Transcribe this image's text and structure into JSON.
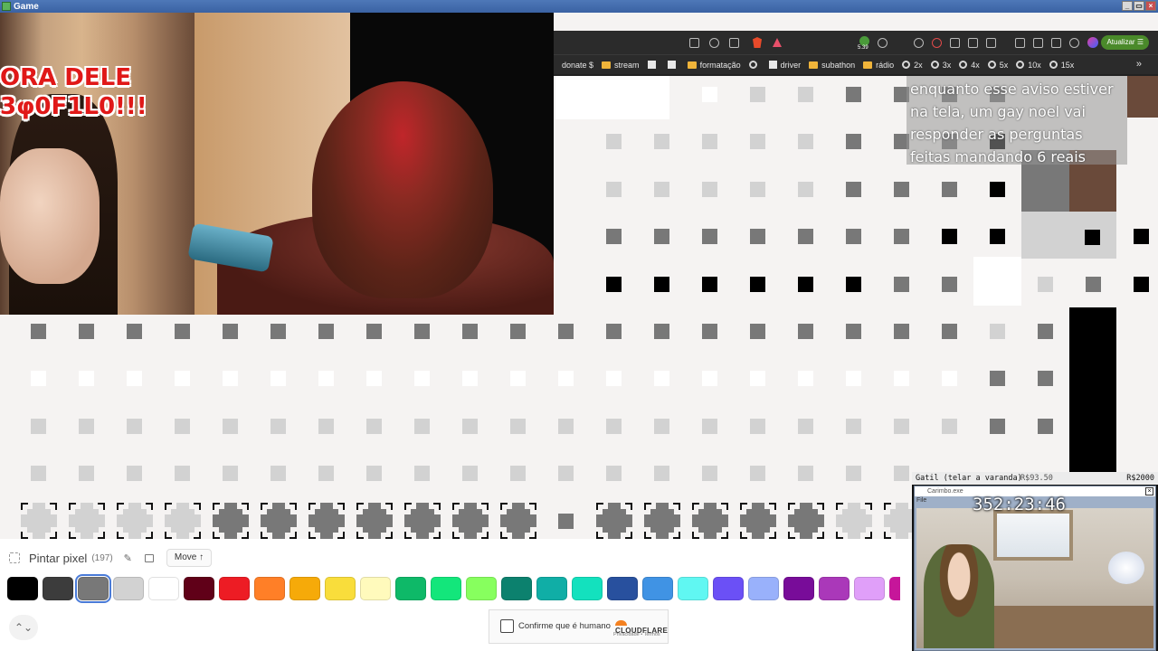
{
  "window": {
    "title": "Game",
    "min": "_",
    "max": "▭",
    "close": "×"
  },
  "overlay": {
    "meme_text": "ORA DELE\n3φ0F1L0!!!",
    "message": "enquanto esse aviso estiver na tela, um gay noel vai responder as perguntas feitas mandando 6 reais"
  },
  "browser": {
    "badge": "5.39",
    "update_label": "Atualizar",
    "bookmarks": [
      {
        "icon": "none",
        "label": "donate $"
      },
      {
        "icon": "folder",
        "label": "stream"
      },
      {
        "icon": "box",
        "label": ""
      },
      {
        "icon": "box",
        "label": ""
      },
      {
        "icon": "folder",
        "label": "formatação"
      },
      {
        "icon": "globe",
        "label": ""
      },
      {
        "icon": "box",
        "label": "driver"
      },
      {
        "icon": "folder",
        "label": "subathon"
      },
      {
        "icon": "folder",
        "label": "rádio"
      },
      {
        "icon": "globe",
        "label": "2x"
      },
      {
        "icon": "globe",
        "label": "3x"
      },
      {
        "icon": "globe",
        "label": "4x"
      },
      {
        "icon": "globe",
        "label": "5x"
      },
      {
        "icon": "globe",
        "label": "10x"
      },
      {
        "icon": "globe",
        "label": "15x"
      }
    ],
    "more": "»"
  },
  "toolbar": {
    "title": "Pintar pixel",
    "count": "(197)",
    "move_label": "Move ↑",
    "palette": [
      "#000000",
      "#3c3c3c",
      "#787878",
      "#d2d2d2",
      "#ffffff",
      "#600018",
      "#ed1c24",
      "#ff7f27",
      "#f6aa09",
      "#f9dd3b",
      "#fffabc",
      "#0eb968",
      "#13e67b",
      "#87ff5e",
      "#0c816e",
      "#10aea6",
      "#13e1be",
      "#28509e",
      "#4093e4",
      "#60f7f2",
      "#6b50f6",
      "#99b1fb",
      "#780c99",
      "#aa38b9",
      "#e09ff9"
    ],
    "selected_index": 2
  },
  "captcha": {
    "label": "Confirme que é humano",
    "brand": "CLOUDFLARE",
    "links": "Privacidade • Termos"
  },
  "stream": {
    "goal_label": "Gatil (telar a varanda)",
    "goal_current": "R$93.50",
    "goal_target": "R$2000",
    "window_title": "Carimbo.exe",
    "window_file": "File",
    "timer": "352:23:46"
  }
}
